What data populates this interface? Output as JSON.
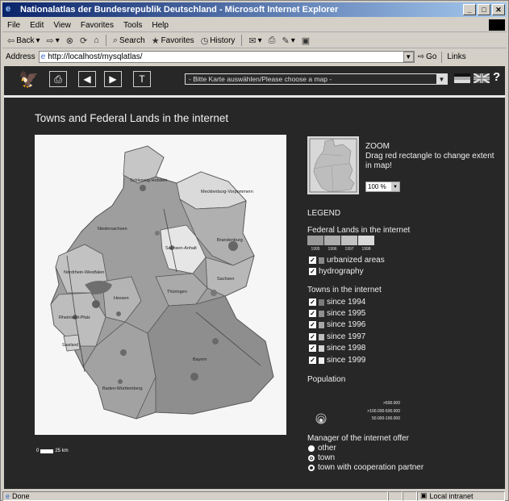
{
  "window": {
    "title": "Nationalatlas der Bundesrepublik Deutschland - Microsoft Internet Explorer"
  },
  "menubar": {
    "items": [
      "File",
      "Edit",
      "View",
      "Favorites",
      "Tools",
      "Help"
    ]
  },
  "toolbar": {
    "back_label": "Back",
    "search_label": "Search",
    "favorites_label": "Favorites",
    "history_label": "History"
  },
  "addressbar": {
    "label": "Address",
    "url": "http://localhost/mysqlatlas/",
    "go_label": "Go",
    "links_label": "Links"
  },
  "nav": {
    "map_select_value": "- Bitte Karte auswählen/Please choose a map -",
    "help_label": "?",
    "text_button_label": "T"
  },
  "page": {
    "title": "Towns and Federal Lands in the internet"
  },
  "map": {
    "state_labels": [
      "Schleswig-Holstein",
      "Mecklenburg-Vorpommern",
      "Niedersachsen",
      "Sachsen-Anhalt",
      "Brandenburg",
      "Nordrhein-Westfalen",
      "Hessen",
      "Thüringen",
      "Sachsen",
      "Rheinland-Pfalz",
      "Saarland",
      "Baden-Württemberg",
      "Bayern"
    ],
    "scale_left": "0",
    "scale_right": "25 km"
  },
  "zoom": {
    "heading": "ZOOM",
    "instruction": "Drag red rectangle to change extent in map!",
    "level": "100 %"
  },
  "legend": {
    "heading": "LEGEND",
    "federal_lands_heading": "Federal Lands in the internet",
    "federal_years": [
      "1995",
      "1996",
      "1997",
      "1998"
    ],
    "federal_colors": [
      "#9a9a9a",
      "#adadad",
      "#c2c2c2",
      "#d8d8d8"
    ],
    "urbanized_label": "urbanized areas",
    "hydrography_label": "hydrography",
    "towns_heading": "Towns in the internet",
    "towns": [
      {
        "label": "since 1994",
        "color": "#7a7a7a"
      },
      {
        "label": "since 1995",
        "color": "#909090"
      },
      {
        "label": "since 1996",
        "color": "#a6a6a6"
      },
      {
        "label": "since 1997",
        "color": "#bcbcbc"
      },
      {
        "label": "since 1998",
        "color": "#d4d4d4"
      },
      {
        "label": "since 1999",
        "color": "#eeeeee"
      }
    ],
    "population_heading": "Population",
    "population_classes": [
      ">500.000",
      ">100.000-500.000",
      "50.000-100.000"
    ],
    "manager_heading": "Manager of the internet offer",
    "manager_items": [
      "other",
      "town",
      "town with cooperation partner"
    ]
  },
  "status": {
    "text": "Done",
    "zone": "Local intranet"
  }
}
